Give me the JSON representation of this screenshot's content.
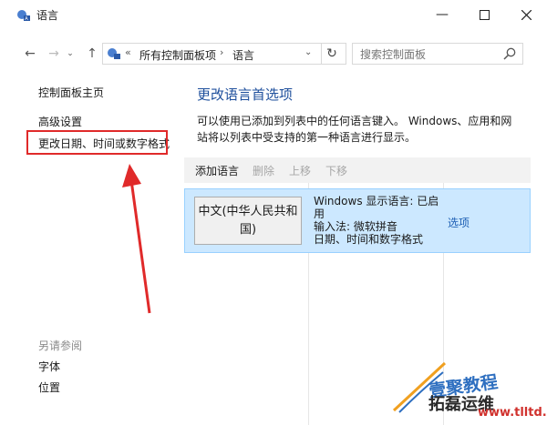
{
  "window": {
    "title": "语言",
    "minimize_icon": "minimize-icon",
    "maximize_icon": "maximize-icon",
    "close_icon": "close-icon"
  },
  "address_bar": {
    "overflow": "«",
    "crumbs": [
      "所有控制面板项",
      "语言"
    ],
    "search_placeholder": "搜索控制面板"
  },
  "left_pane": {
    "home": "控制面板主页",
    "advanced": "高级设置",
    "change_date": "更改日期、时间或数字格式",
    "see_also": "另请参阅",
    "fonts": "字体",
    "location": "位置"
  },
  "main": {
    "heading": "更改语言首选项",
    "description": "可以使用已添加到列表中的任何语言键入。 Windows、应用和网站将以列表中受支持的第一种语言进行显示。",
    "toolbar": {
      "add": "添加语言",
      "remove": "删除",
      "move_up": "上移",
      "move_down": "下移"
    },
    "languages": [
      {
        "name": "中文(中华人民共和国)",
        "info_line1": "Windows 显示语言: 已启用",
        "info_line2": "输入法: 微软拼音",
        "info_line3": "日期、时间和数字格式",
        "options": "选项"
      }
    ]
  },
  "watermark": {
    "line1": "壹聚教程",
    "line2": "拓磊运维",
    "url": "www.tlltd.cn"
  },
  "colors": {
    "link_blue": "#1e4f9c",
    "selection": "#cce8ff",
    "annotation_red": "#e02a2a"
  }
}
